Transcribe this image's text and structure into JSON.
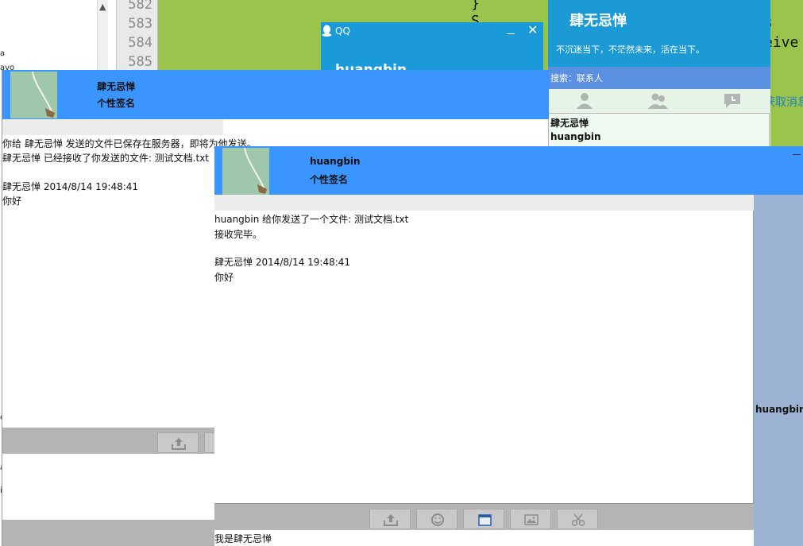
{
  "ide": {
    "line_numbers": [
      "582",
      "583",
      "584",
      "585"
    ],
    "code_fragments": [
      "}",
      "S",
      "s",
      "eive",
      "获取消息"
    ],
    "tree_fragments": [
      "a",
      "avo",
      "c",
      "a",
      "i"
    ]
  },
  "qq_popup": {
    "title": "QQ",
    "name": "huangbin"
  },
  "contact_panel": {
    "name": "肆无忌惮",
    "signature": "不沉迷当下，不茫然未来，活在当下。",
    "search_label": "搜索：联系人",
    "contacts": [
      "肆无忌惮",
      "huangbin"
    ]
  },
  "chat_back": {
    "name": "肆无忌惮",
    "signature": "个性签名",
    "messages": [
      "你给 肆无忌惮 发送的文件已保存在服务器，即将为他发送。",
      "肆无忌惮    已经接收了你发送的文件: 测试文档.txt",
      "肆无忌惮    2014/8/14  19:48:41",
      "你好"
    ]
  },
  "chat_front": {
    "name": "huangbin",
    "signature": "个性签名",
    "messages": [
      "huangbin    给你发送了一个文件: 测试文档.txt",
      "接收完毕。",
      "肆无忌惮    2014/8/14  19:48:41",
      "你好"
    ],
    "input_text": "我是肆无忌惮",
    "side_name": "huangbin",
    "toolbar_icons": [
      "upload-icon",
      "emoji-icon",
      "window-icon",
      "image-icon",
      "scissors-icon"
    ]
  },
  "colors": {
    "header_blue": "#3a95ff",
    "qq_blue": "#1a9ad8",
    "editor_green": "#99c34a",
    "side_panel": "#9cb3d3"
  }
}
